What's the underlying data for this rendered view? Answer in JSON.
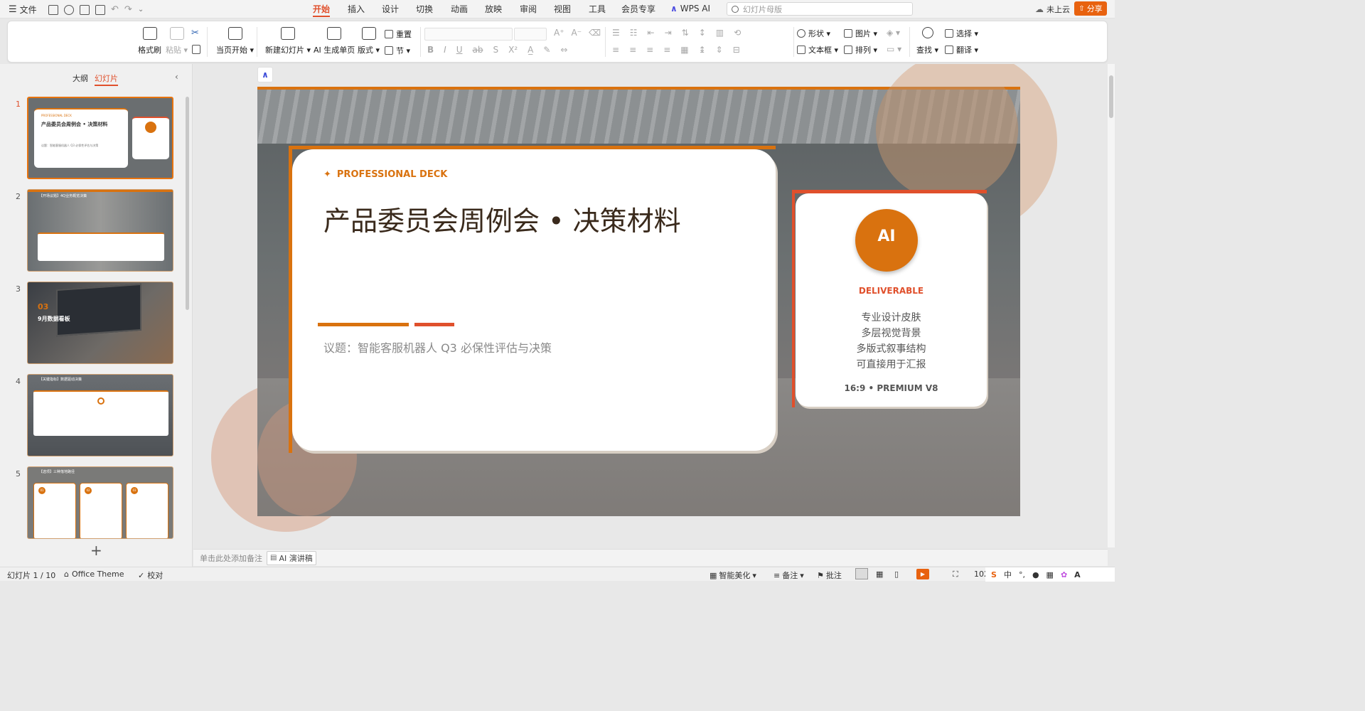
{
  "titlebar": {
    "file_menu": "文件",
    "tabs": [
      {
        "label": "开始",
        "active": true
      },
      {
        "label": "插入"
      },
      {
        "label": "设计"
      },
      {
        "label": "切换"
      },
      {
        "label": "动画"
      },
      {
        "label": "放映"
      },
      {
        "label": "审阅"
      },
      {
        "label": "视图"
      },
      {
        "label": "工具"
      },
      {
        "label": "会员专享"
      }
    ],
    "wps_ai": "WPS AI",
    "search_placeholder": "幻灯片母版",
    "cloud_status": "未上云",
    "share_label": "分享",
    "accent": "#e0502c"
  },
  "ribbon": {
    "format_painter": "格式刷",
    "paste": "粘贴",
    "start_from_current": "当页开始",
    "new_slide": "新建幻灯片",
    "ai_single_page": "AI 生成单页",
    "layout": "版式",
    "reset": "重置",
    "section": "节",
    "shape": "形状",
    "picture": "图片",
    "textbox": "文本框",
    "arrange": "排列",
    "find": "查找",
    "select": "选择",
    "translate": "翻译"
  },
  "panel": {
    "tab_outline": "大纲",
    "tab_slides": "幻灯片",
    "thumbs": [
      {
        "num": "1",
        "header": "PROFESSIONAL DECK",
        "title": "产品委员会周例会 • 决策材料",
        "subtitle": "议题：智能客服机器人 Q3 必保性评估与决策"
      },
      {
        "num": "2",
        "title": "【开场议题】4Q业务概览决策"
      },
      {
        "num": "3",
        "index": "03",
        "title": "9月数据看板"
      },
      {
        "num": "4",
        "title": "【关键指标】数据驱动决策"
      },
      {
        "num": "5",
        "title": "【选项】三种落地路径",
        "cards": [
          "01",
          "02",
          "03"
        ]
      }
    ]
  },
  "slide": {
    "header": "PROFESSIONAL DECK",
    "title": "产品委员会周例会 • 决策材料",
    "subtitle": "议题：智能客服机器人 Q3 必保性评估与决策",
    "badge": "AI",
    "badge_label": "DELIVERABLE",
    "features": [
      "专业设计皮肤",
      "多层视觉背景",
      "多版式叙事结构",
      "可直接用于汇报"
    ],
    "footer_note": "16:9 • PREMIUM V8",
    "accent": "#d9720f",
    "accent_dark": "#e0502c"
  },
  "notes": {
    "placeholder": "单击此处添加备注",
    "ai_script": "AI 演讲稿"
  },
  "status": {
    "slide_info": "幻灯片 1 / 10",
    "theme": "Office Theme",
    "proof": "校对",
    "beautify": "智能美化",
    "notes": "备注",
    "comments": "批注",
    "zoom": "102",
    "ime": "中"
  }
}
